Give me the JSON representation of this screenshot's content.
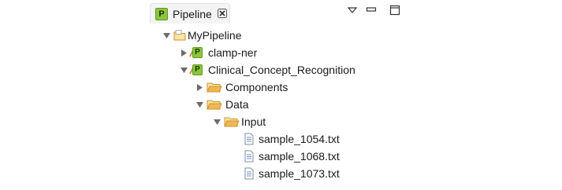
{
  "view": {
    "tab_icon_letter": "P",
    "tab_title": "Pipeline",
    "icons": {
      "close": "close-icon",
      "view_menu": "view-menu-icon",
      "minimize": "minimize-icon",
      "maximize": "maximize-icon"
    }
  },
  "tree": {
    "root": {
      "label": "MyPipeline",
      "expanded": true,
      "icon": "project-folder-icon"
    },
    "project_clamp": {
      "label": "clamp-ner",
      "expanded": false,
      "icon": "pipeline-project-icon",
      "badge": "P"
    },
    "project_clinical": {
      "label": "Clinical_Concept_Recognition",
      "expanded": true,
      "icon": "pipeline-project-icon",
      "badge": "P"
    },
    "folder_components": {
      "label": "Components",
      "expanded": false,
      "icon": "folder-icon"
    },
    "folder_data": {
      "label": "Data",
      "expanded": true,
      "icon": "folder-open-icon"
    },
    "folder_input": {
      "label": "Input",
      "expanded": true,
      "icon": "folder-open-icon"
    },
    "files": [
      {
        "label": "sample_1054.txt",
        "icon": "text-file-icon"
      },
      {
        "label": "sample_1068.txt",
        "icon": "text-file-icon"
      },
      {
        "label": "sample_1073.txt",
        "icon": "text-file-icon"
      }
    ]
  },
  "colors": {
    "project_badge": "#8cc63f",
    "folder": "#f2b64f",
    "twisty": "#6b6b6b"
  }
}
